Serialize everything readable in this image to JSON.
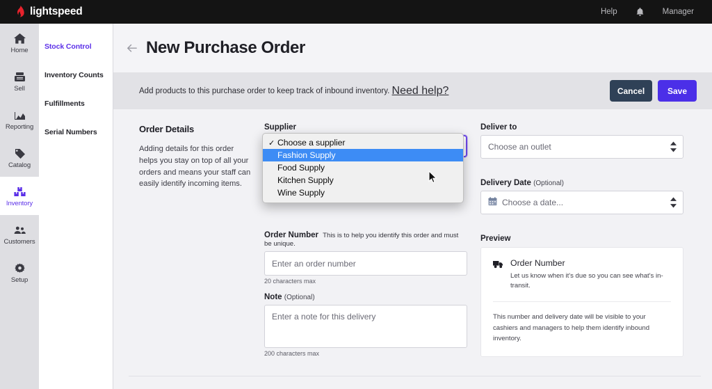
{
  "topbar": {
    "brand": "lightspeed",
    "brand_icon": "flame-icon",
    "help_label": "Help",
    "bell_icon": "bell-icon",
    "user_label": "Manager",
    "background": "#141414"
  },
  "rail": {
    "items": [
      {
        "label": "Home",
        "icon": "home-icon",
        "active": false
      },
      {
        "label": "Sell",
        "icon": "register-icon",
        "active": false
      },
      {
        "label": "Reporting",
        "icon": "chart-icon",
        "active": false
      },
      {
        "label": "Catalog",
        "icon": "tag-icon",
        "active": false
      },
      {
        "label": "Inventory",
        "icon": "boxes-icon",
        "active": true
      },
      {
        "label": "Customers",
        "icon": "people-icon",
        "active": false
      },
      {
        "label": "Setup",
        "icon": "gear-icon",
        "active": false
      }
    ],
    "active_color": "#5b2fe8"
  },
  "subnav": {
    "items": [
      {
        "label": "Stock Control",
        "active": true
      },
      {
        "label": "Inventory Counts",
        "active": false
      },
      {
        "label": "Fulfillments",
        "active": false
      },
      {
        "label": "Serial Numbers",
        "active": false
      }
    ]
  },
  "header": {
    "back_icon": "back-arrow-icon",
    "title": "New Purchase Order"
  },
  "notice": {
    "text": "Add products to this purchase order to keep track of inbound inventory.",
    "link_label": "Need help?",
    "cancel_label": "Cancel",
    "save_label": "Save",
    "cancel_color": "#2f4157",
    "save_color": "#4b2fe8"
  },
  "order_details": {
    "heading": "Order Details",
    "description": "Adding details for this order helps you stay on top of all your orders and means your staff can easily identify incoming items."
  },
  "supplier": {
    "label": "Supplier",
    "value": "Choose a supplier",
    "dropdown_open": true,
    "options": [
      {
        "label": "Choose a supplier",
        "checked": true,
        "highlighted": false
      },
      {
        "label": "Fashion Supply",
        "checked": false,
        "highlighted": true
      },
      {
        "label": "Food Supply",
        "checked": false,
        "highlighted": false
      },
      {
        "label": "Kitchen Supply",
        "checked": false,
        "highlighted": false
      },
      {
        "label": "Wine Supply",
        "checked": false,
        "highlighted": false
      }
    ],
    "highlight_color": "#3d8cf5",
    "focus_ring_color": "#6e48ec"
  },
  "order_number": {
    "label": "Order Number",
    "hint_inline": "This is to help you identify this order and must be unique.",
    "placeholder": "Enter an order number",
    "value": "",
    "char_hint": "20 characters max"
  },
  "note": {
    "label": "Note",
    "optional": "(Optional)",
    "placeholder": "Enter a note for this delivery",
    "value": "",
    "char_hint": "200 characters max"
  },
  "deliver_to": {
    "label": "Deliver to",
    "placeholder": "Choose an outlet",
    "value": ""
  },
  "delivery_date": {
    "label": "Delivery Date",
    "optional": "(Optional)",
    "placeholder": "Choose a date...",
    "value": "",
    "calendar_icon": "calendar-icon"
  },
  "preview": {
    "title": "Preview",
    "card_icon": "truck-icon",
    "card_heading": "Order Number",
    "card_sub": "Let us know when it's due so you can see what's in-transit.",
    "card_footer": "This number and delivery date will be visible to your cashiers and managers to help them identify inbound inventory."
  },
  "arrow_between_columns": "→"
}
